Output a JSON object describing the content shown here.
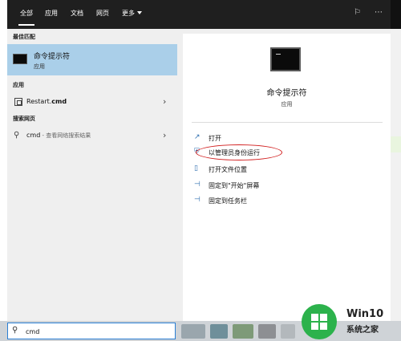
{
  "tabs": [
    "全部",
    "应用",
    "文档",
    "网页",
    "更多"
  ],
  "sections": {
    "best_match": "最佳匹配",
    "apps": "应用",
    "web": "搜索网页"
  },
  "best_match": {
    "title": "命令提示符",
    "subtitle": "应用"
  },
  "apps_list": [
    {
      "label": "Restart.",
      "label_bold": "cmd"
    }
  ],
  "web_result": {
    "query": "cmd",
    "hint": " - 查看网络搜索结果"
  },
  "preview": {
    "title": "命令提示符",
    "subtitle": "应用"
  },
  "actions": [
    "打开",
    "以管理员身份运行",
    "打开文件位置",
    "固定到\"开始\"屏幕",
    "固定到任务栏"
  ],
  "search": {
    "value": "cmd"
  },
  "watermark": {
    "line1": "Win10",
    "line2": "系统之家"
  },
  "colors": {
    "highlight_row": "#aacfe9",
    "topbar": "#1f1f1f",
    "annotation_red": "#d11d1d",
    "logo_green": "#2cb24c"
  }
}
